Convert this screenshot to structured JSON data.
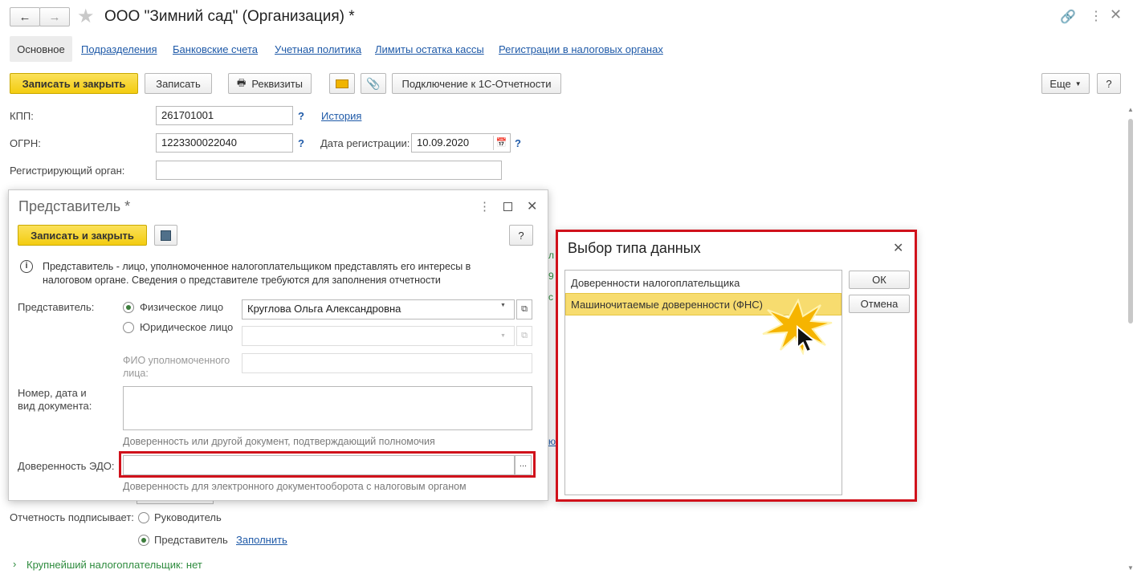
{
  "window": {
    "title": "ООО \"Зимний сад\" (Организация) *"
  },
  "tabs": [
    {
      "label": "Основное"
    },
    {
      "label": "Подразделения"
    },
    {
      "label": "Банковские счета"
    },
    {
      "label": "Учетная политика"
    },
    {
      "label": "Лимиты остатка кассы"
    },
    {
      "label": "Регистрации в налоговых органах"
    }
  ],
  "toolbar": {
    "save_close": "Записать и закрыть",
    "save": "Записать",
    "requisites": "Реквизиты",
    "connect": "Подключение к 1С-Отчетности",
    "more": "Еще",
    "help": "?"
  },
  "form": {
    "kpp_label": "КПП:",
    "kpp_value": "261701001",
    "history_link": "История",
    "ogrn_label": "ОГРН:",
    "ogrn_value": "1223300022040",
    "reg_date_label": "Дата регистрации:",
    "reg_date_value": "10.09.2020",
    "reg_organ_label": "Регистрирующий орган:",
    "reg_organ_value": "",
    "signs_label": "Отчетность подписывает:",
    "signs_option1": "Руководитель",
    "signs_option2": "Представитель",
    "fill_link": "Заполнить",
    "largest_taxpayer": "Крупнейший налогоплательщик: нет",
    "q": "?"
  },
  "rep_dialog": {
    "title": "Представитель *",
    "save_close": "Записать и закрыть",
    "help": "?",
    "info": "Представитель - лицо, уполномоченное налогоплательщиком представлять его интересы в налоговом органе. Сведения о представителе требуются для заполнения отчетности",
    "rep_label": "Представитель:",
    "radio_person": "Физическое лицо",
    "radio_legal": "Юридическое лицо",
    "person_value": "Круглова Ольга Александровна",
    "fio_label": "ФИО уполномоченного лица:",
    "doc_label": "Номер, дата и вид документа:",
    "doc_hint": "Доверенность или другой документ, подтверждающий полномочия",
    "edo_label": "Доверенность ЭДО:",
    "edo_value": "",
    "edo_hint": "Доверенность для электронного документооборота с налоговым органом",
    "ellipsis": "..."
  },
  "type_dialog": {
    "title": "Выбор типа данных",
    "items": [
      {
        "label": "Доверенности налогоплательщика"
      },
      {
        "label": "Машиночитаемые доверенности (ФНС)"
      }
    ],
    "selected_index": 1,
    "ok": "ОК",
    "cancel": "Отмена"
  },
  "colors": {
    "accent_yellow": "#f3cc10",
    "highlight_red": "#d0111b",
    "link_blue": "#1f5aa8",
    "green_text": "#2e8b3e"
  }
}
